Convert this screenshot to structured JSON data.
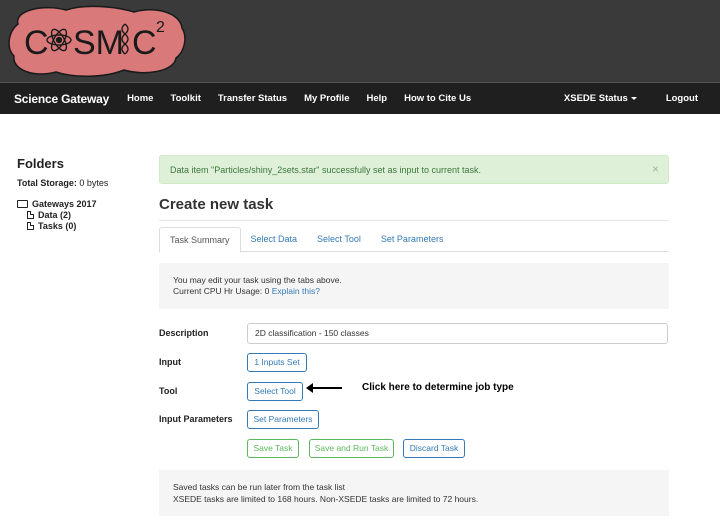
{
  "logo": {
    "text_left": "C",
    "text_right": "SMIC",
    "superscript": "2",
    "bg_color": "#d9797a"
  },
  "navbar": {
    "brand": "Science Gateway",
    "links": [
      "Home",
      "Toolkit",
      "Transfer Status",
      "My Profile",
      "Help",
      "How to Cite Us"
    ],
    "status": "XSEDE Status",
    "logout": "Logout"
  },
  "sidebar": {
    "title": "Folders",
    "storage_label": "Total Storage:",
    "storage_value": "0 bytes",
    "folder": "Gateways 2017",
    "items": [
      "Data (2)",
      "Tasks (0)"
    ]
  },
  "alert": {
    "message": "Data item \"Particles/shiny_2sets.star\" successfully set as input to current task.",
    "close": "×",
    "color": "#3c763d"
  },
  "main": {
    "title": "Create new task",
    "tabs": [
      "Task Summary",
      "Select Data",
      "Select Tool",
      "Set Parameters"
    ],
    "info_line1": "You may edit your task using the tabs above.",
    "info_line2_prefix": "Current CPU Hr Usage: 0",
    "info_link": "Explain this?"
  },
  "form": {
    "description_label": "Description",
    "description_value": "2D classification - 150 classes",
    "input_label": "Input",
    "input_button": "1 Inputs Set",
    "tool_label": "Tool",
    "tool_button": "Select Tool",
    "params_label": "Input Parameters",
    "params_button": "Set Parameters",
    "save": "Save Task",
    "save_run": "Save and Run Task",
    "discard": "Discard Task"
  },
  "annotation": {
    "text": "Click here to determine job type"
  },
  "footer_note": {
    "line1": "Saved tasks can be run later from the task list",
    "line2": "XSEDE tasks are limited to 168 hours. Non-XSEDE tasks are limited to 72 hours."
  }
}
